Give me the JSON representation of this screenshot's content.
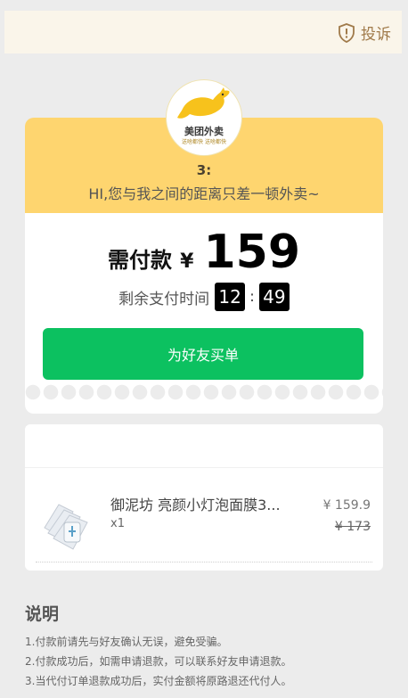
{
  "header": {
    "complain_label": "投诉",
    "complain_icon": "shield-alert-icon"
  },
  "shop": {
    "logo_title": "美团外卖",
    "logo_sub": "送啥都快 送啥都快",
    "logo_icon": "kangaroo-logo-icon",
    "name": "3:",
    "slogan": "HI,您与我之间的距离只差一顿外卖~"
  },
  "payment": {
    "label": "需付款",
    "currency": "¥",
    "amount": "159",
    "timer_label": "剩余支付时间",
    "minutes": "12",
    "colon": ":",
    "seconds": "49",
    "button_label": "为好友买单"
  },
  "order": {
    "item_name": "御泥坊 亮颜小灯泡面膜3...",
    "qty": "x1",
    "price": "¥ 159.9",
    "original_price": "¥ 173"
  },
  "notes": {
    "title": "说明",
    "lines": [
      "1.付款前请先与好友确认无误，避免受骗。",
      "2.付款成功后，如需申请退款，可以联系好友申请退款。",
      "3.当代付订单退款成功后，实付金额将原路退还代付人。"
    ]
  },
  "colors": {
    "accent_yellow": "#fed56f",
    "button_green": "#0cc160",
    "complain_brown": "#a07a4a"
  }
}
